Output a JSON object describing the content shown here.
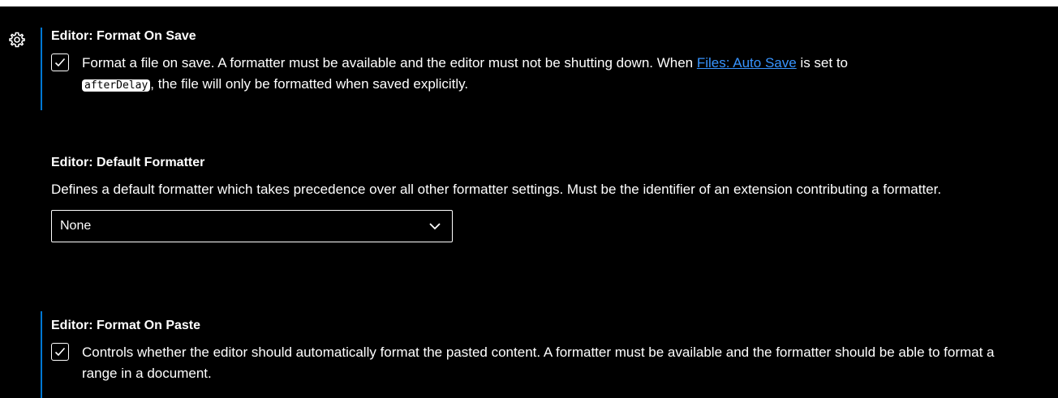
{
  "colors": {
    "background": "#000000",
    "foreground": "#ffffff",
    "link": "#3794ff",
    "modified_indicator": "#0078d4"
  },
  "format_on_save": {
    "title": "Editor: Format On Save",
    "checked": true,
    "desc_part1": "Format a file on save. A formatter must be available and the editor must not be shutting down. When ",
    "link_text": "Files: Auto Save",
    "desc_part2": " is set to ",
    "code_text": "afterDelay",
    "desc_part3": ", the file will only be formatted when saved explicitly.",
    "gear_icon": "gear-icon"
  },
  "default_formatter": {
    "title": "Editor: Default Formatter",
    "description": "Defines a default formatter which takes precedence over all other formatter settings. Must be the identifier of an extension contributing a formatter.",
    "selected_value": "None",
    "dropdown_icon": "chevron-down-icon"
  },
  "format_on_paste": {
    "title": "Editor: Format On Paste",
    "checked": true,
    "description": "Controls whether the editor should automatically format the pasted content. A formatter must be available and the formatter should be able to format a range in a document."
  }
}
